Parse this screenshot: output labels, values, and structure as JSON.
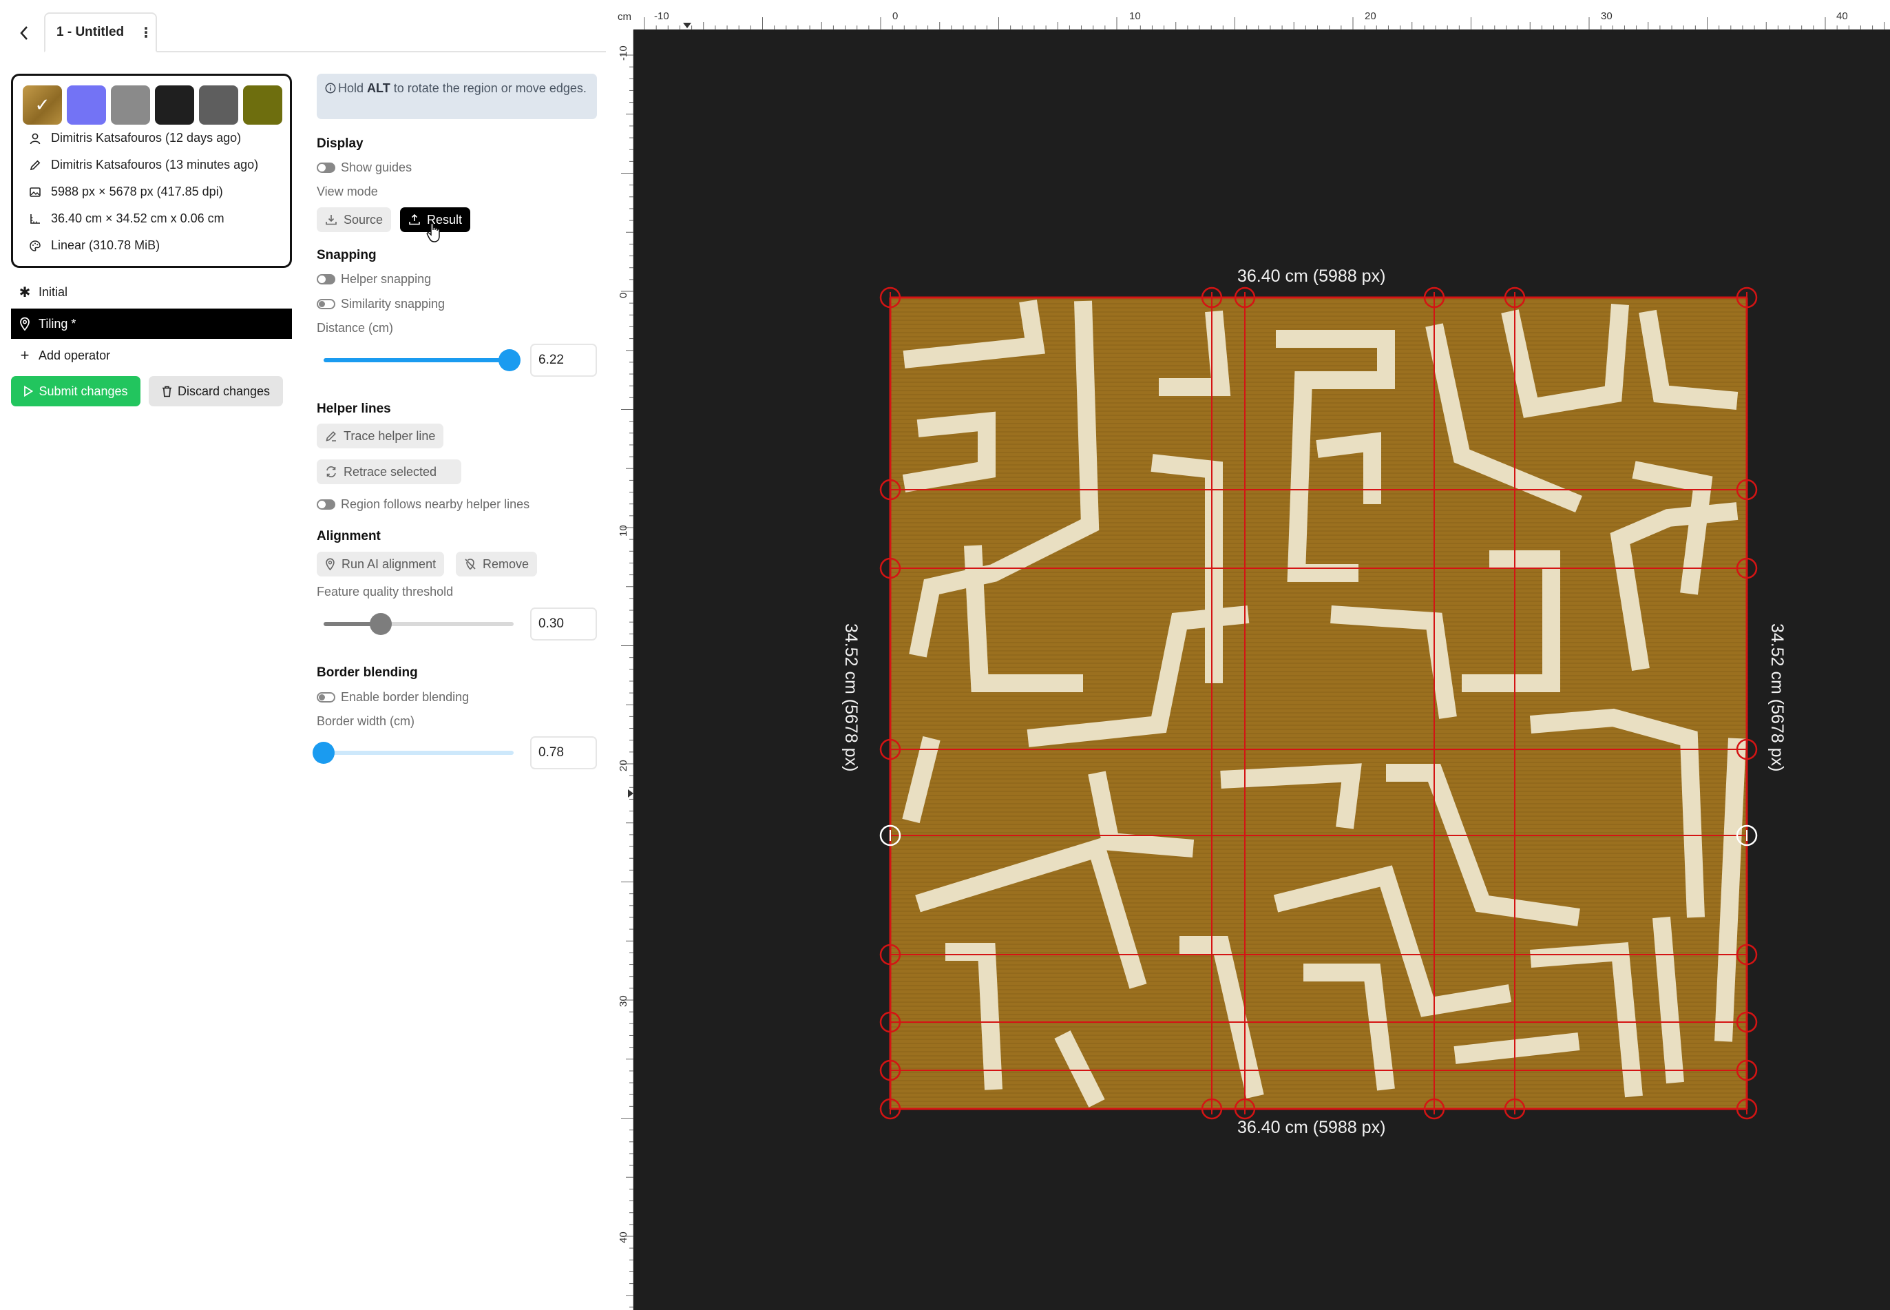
{
  "header": {
    "doc_title": "1 - Untitled",
    "menu_glyph": "⋮"
  },
  "info": {
    "swatches": [
      "#b08a3a",
      "#7373f5",
      "#8a8a8a",
      "#1f1f1f",
      "#5e5e5e",
      "#6e6e0e"
    ],
    "created": "Dimitris Katsafouros (12 days ago)",
    "edited": "Dimitris Katsafouros (13 minutes ago)",
    "pixels": "5988 px × 5678 px (417.85 dpi)",
    "physical": "36.40 cm × 34.52 cm  x 0.06 cm",
    "colorspace": "Linear (310.78 MiB)"
  },
  "operators": {
    "items": [
      {
        "label": "Initial",
        "icon": "asterisk-icon"
      },
      {
        "label": "Tiling *",
        "icon": "map-pin-icon"
      }
    ],
    "add_label": "Add operator"
  },
  "actions": {
    "submit": "Submit changes",
    "discard": "Discard changes"
  },
  "settings": {
    "hint_prefix": "Hold ",
    "hint_key": "ALT",
    "hint_rest": " to rotate the region or move edges.",
    "display": {
      "title": "Display",
      "show_guides": "Show guides",
      "view_mode_label": "View mode",
      "source": "Source",
      "result": "Result"
    },
    "snapping": {
      "title": "Snapping",
      "helper": "Helper snapping",
      "similarity": "Similarity snapping",
      "distance_label": "Distance (cm)",
      "distance_value": "6.22",
      "distance_fraction": 0.98
    },
    "helper_lines": {
      "title": "Helper lines",
      "trace": "Trace helper line",
      "retrace": "Retrace selected",
      "follows": "Region follows nearby helper lines"
    },
    "alignment": {
      "title": "Alignment",
      "run": "Run AI alignment",
      "remove": "Remove",
      "threshold_label": "Feature quality threshold",
      "threshold_value": "0.30",
      "threshold_fraction": 0.3
    },
    "border": {
      "title": "Border blending",
      "enable": "Enable border blending",
      "width_label": "Border width (cm)",
      "width_value": "0.78",
      "width_fraction": 0.0
    }
  },
  "viewer": {
    "ruler_unit": "cm",
    "top_ticks": [
      "-10",
      "0",
      "10",
      "20",
      "30",
      "40"
    ],
    "left_ticks": [
      "-10",
      "0",
      "10",
      "20",
      "30",
      "40"
    ],
    "width_label": "36.40 cm (5988 px)",
    "height_label": "34.52 cm (5678 px)",
    "accent": "#d41414"
  }
}
